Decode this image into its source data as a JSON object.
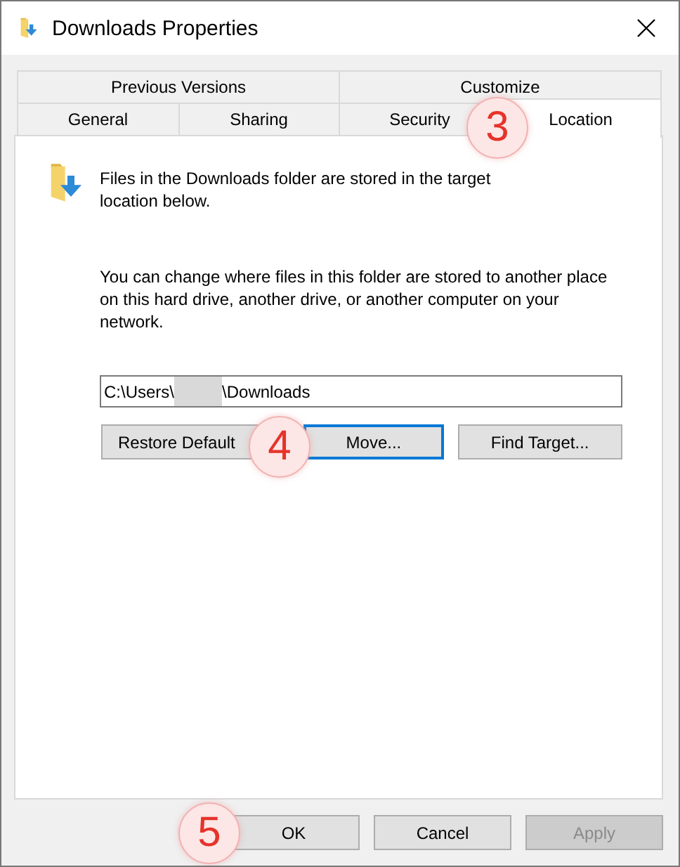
{
  "window": {
    "title": "Downloads Properties"
  },
  "tabs": {
    "step_marker": "3",
    "rows": [
      [
        {
          "label": "Previous Versions",
          "selected": false
        },
        {
          "label": "Customize",
          "selected": false
        }
      ],
      [
        {
          "label": "General",
          "selected": false
        },
        {
          "label": "Sharing",
          "selected": false
        },
        {
          "label": "Security",
          "selected": false
        },
        {
          "label": "Location",
          "selected": true
        }
      ]
    ]
  },
  "intro": "Files in the Downloads folder are stored in the target location below.",
  "description": "You can change where files in this folder are stored to another place on this hard drive, another drive, or another computer on your network.",
  "location_field": {
    "value_start": "C:\\Users\\",
    "redacted": true,
    "value_end": "\\Downloads"
  },
  "location_actions": {
    "step_marker": "4",
    "buttons": [
      {
        "label": "Restore Default",
        "focused": false
      },
      {
        "label": "Move...",
        "focused": true
      },
      {
        "label": "Find Target...",
        "focused": false
      }
    ]
  },
  "dialog_actions": {
    "step_marker": "5",
    "buttons": [
      {
        "label": "OK",
        "disabled": false
      },
      {
        "label": "Cancel",
        "disabled": false
      },
      {
        "label": "Apply",
        "disabled": true
      }
    ]
  }
}
